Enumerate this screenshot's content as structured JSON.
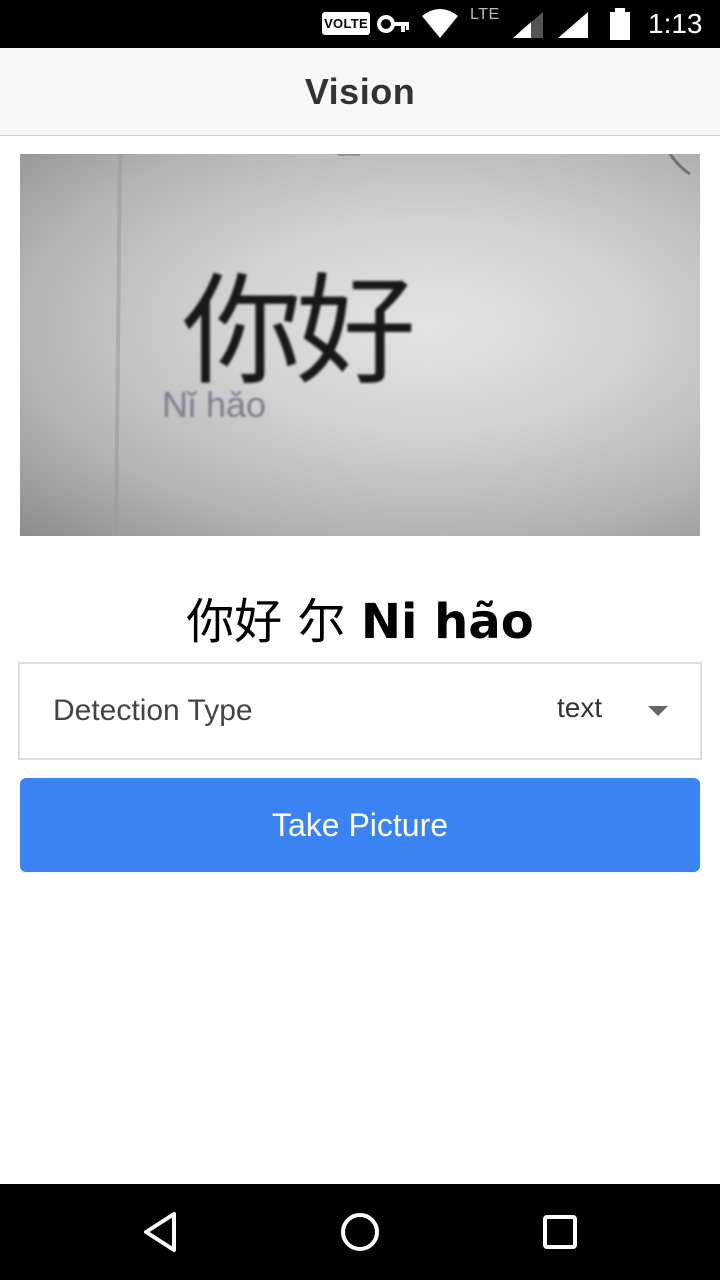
{
  "status_bar": {
    "volte": "VOLTE",
    "lte": "LTE",
    "time": "1:13",
    "icons": [
      "key-icon",
      "wifi-icon",
      "signal-icon",
      "signal-icon",
      "battery-icon"
    ]
  },
  "app_bar": {
    "title": "Vision"
  },
  "photo": {
    "hanzi": "你好",
    "pinyin": "Nǐ hǎo"
  },
  "result": {
    "text_regular": "你好 尔 ",
    "text_bold": "Ni hão"
  },
  "detection": {
    "label": "Detection Type",
    "selected_value": "text"
  },
  "take_picture": {
    "label": "Take Picture",
    "color": "#3b82f2"
  },
  "nav_bar": {
    "icons": [
      "back-icon",
      "home-icon",
      "recents-icon"
    ]
  }
}
